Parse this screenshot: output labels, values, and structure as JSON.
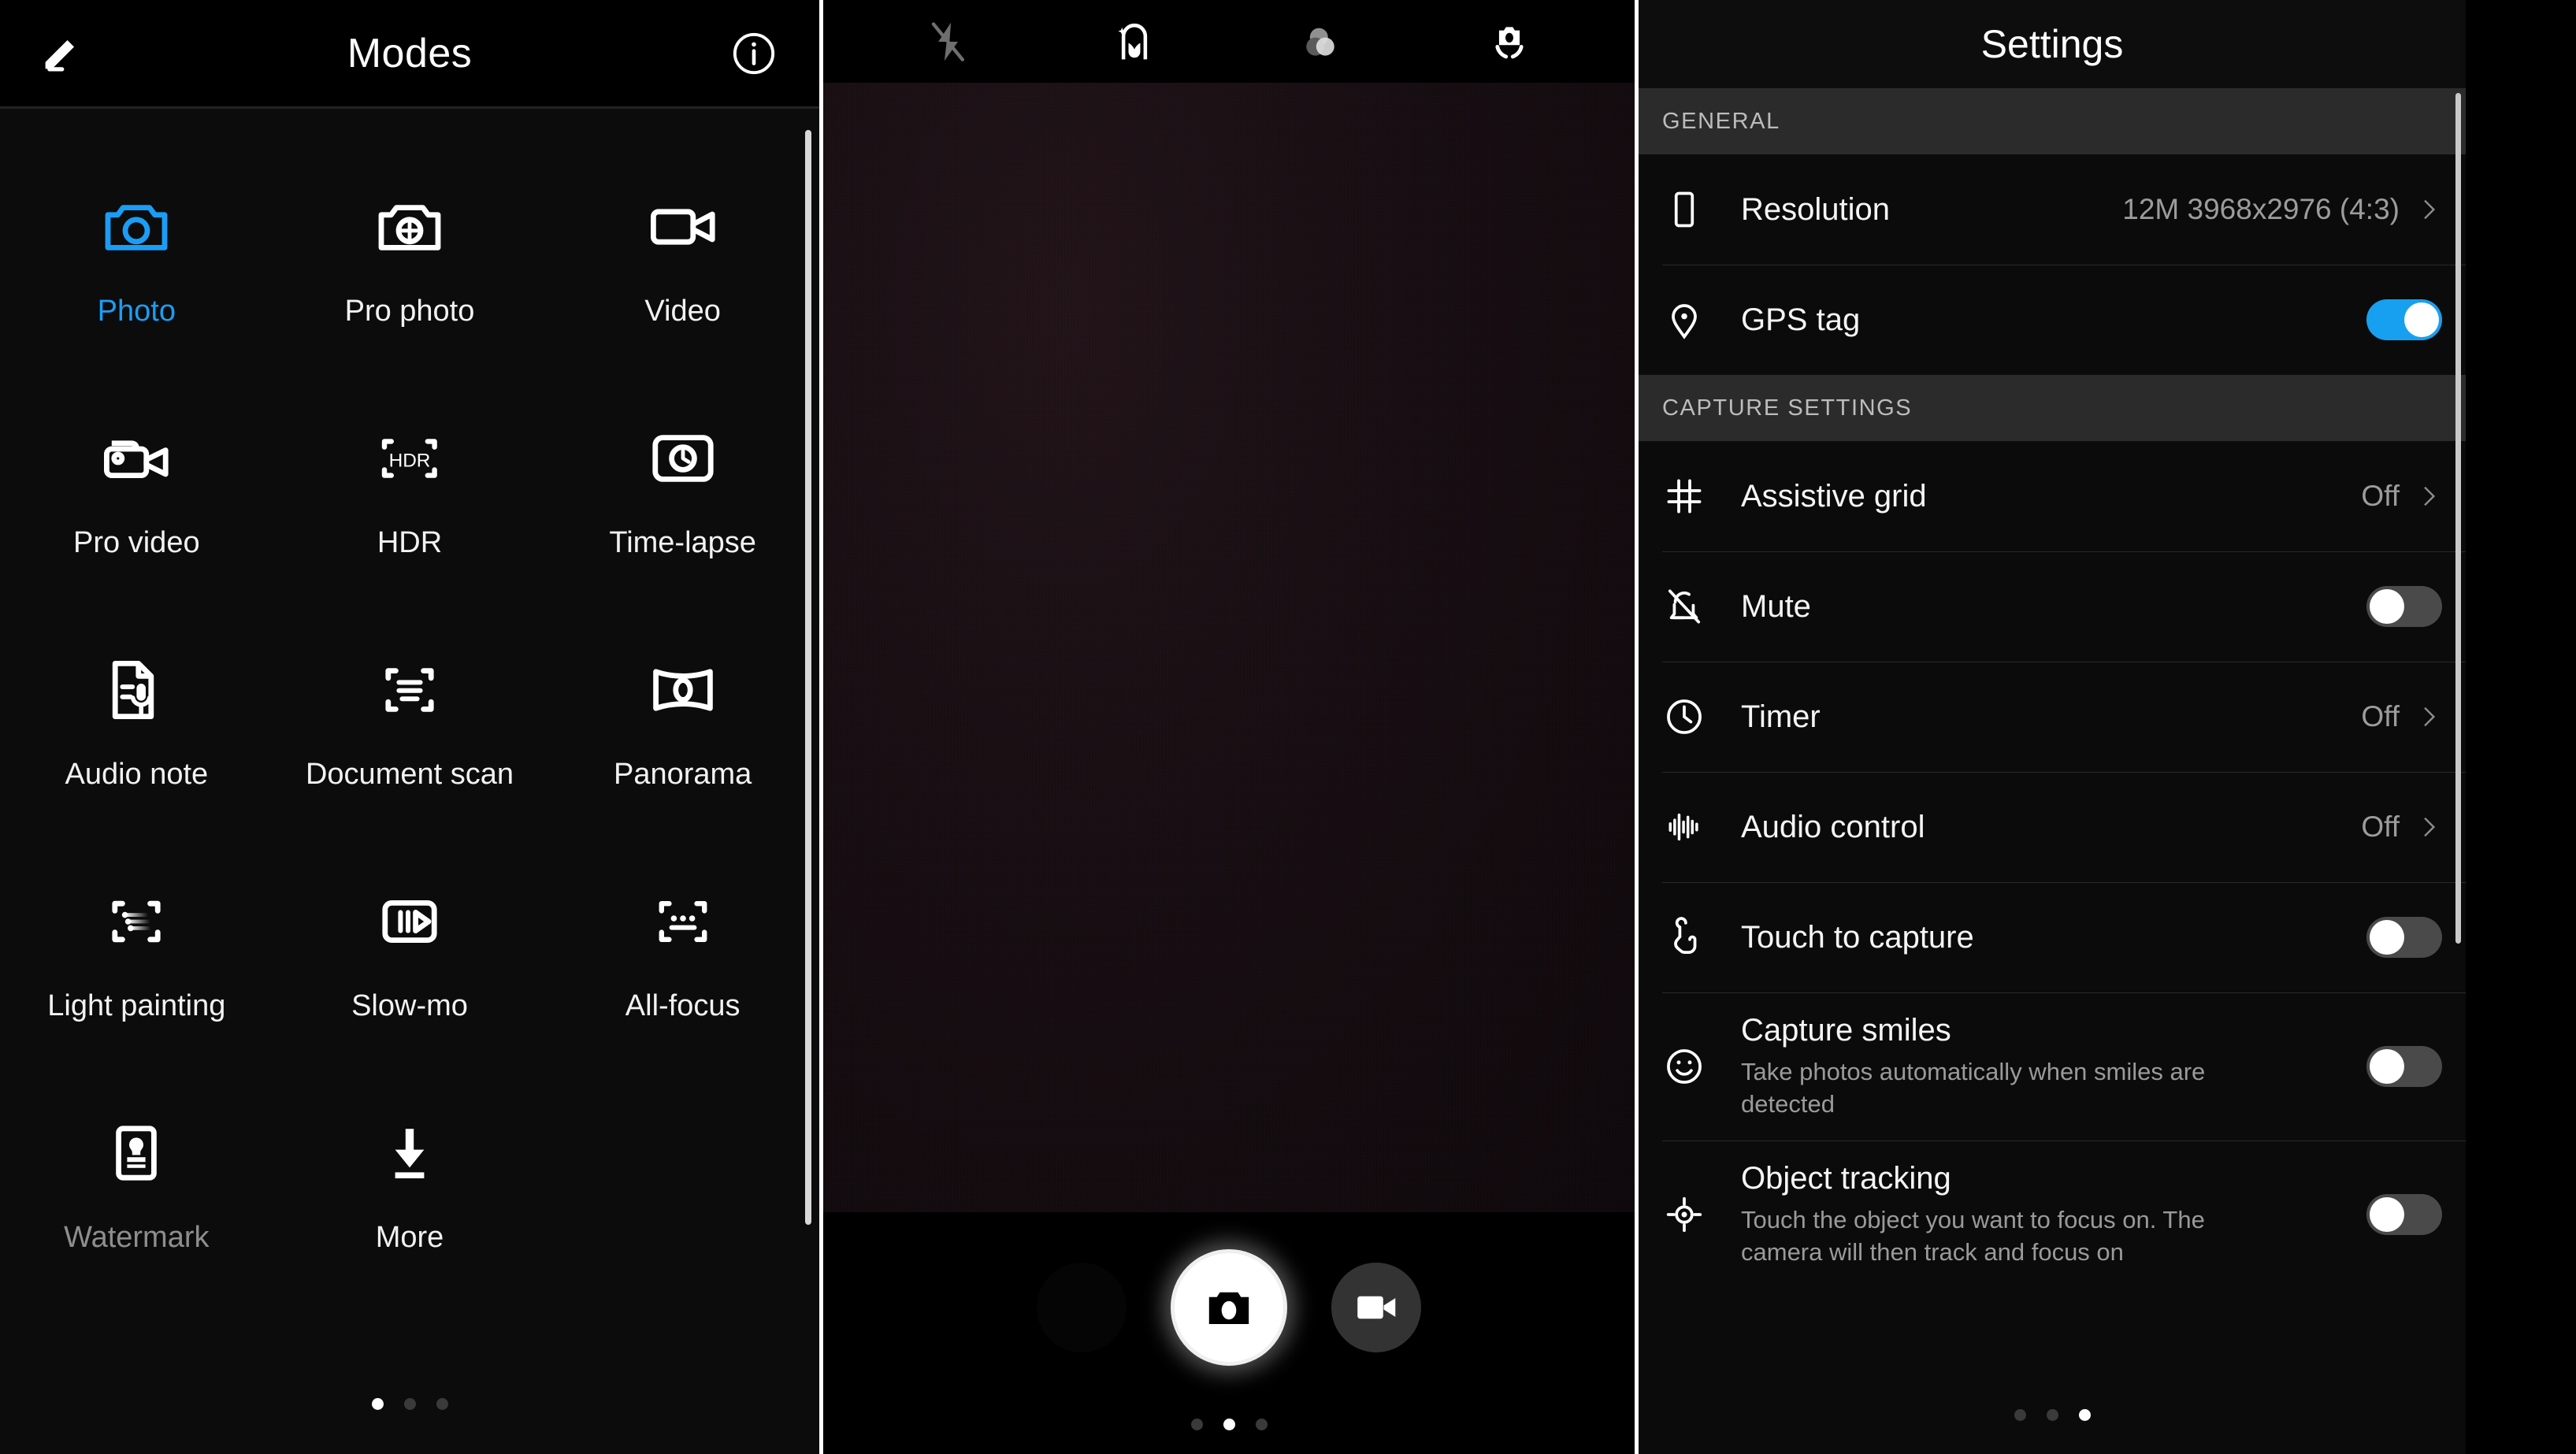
{
  "modes_panel": {
    "header": {
      "title": "Modes",
      "left_icon": "edit-pencil-icon",
      "right_icon": "info-icon"
    },
    "modes": [
      {
        "label": "Photo",
        "icon": "camera-icon",
        "state": "active"
      },
      {
        "label": "Pro photo",
        "icon": "pro-photo-icon",
        "state": "normal"
      },
      {
        "label": "Video",
        "icon": "video-camera-icon",
        "state": "normal"
      },
      {
        "label": "Pro video",
        "icon": "pro-video-icon",
        "state": "normal"
      },
      {
        "label": "HDR",
        "icon": "hdr-icon",
        "state": "normal"
      },
      {
        "label": "Time-lapse",
        "icon": "time-lapse-icon",
        "state": "normal"
      },
      {
        "label": "Audio note",
        "icon": "audio-note-icon",
        "state": "normal"
      },
      {
        "label": "Document scan",
        "icon": "document-scan-icon",
        "state": "normal"
      },
      {
        "label": "Panorama",
        "icon": "panorama-icon",
        "state": "normal"
      },
      {
        "label": "Light painting",
        "icon": "light-painting-icon",
        "state": "normal"
      },
      {
        "label": "Slow-mo",
        "icon": "slow-motion-icon",
        "state": "normal"
      },
      {
        "label": "All-focus",
        "icon": "all-focus-icon",
        "state": "normal"
      },
      {
        "label": "Watermark",
        "icon": "watermark-stamp-icon",
        "state": "dim"
      },
      {
        "label": "More",
        "icon": "download-arrow-icon",
        "state": "normal"
      }
    ],
    "page_dots": {
      "count": 3,
      "active_index": 0
    }
  },
  "viewfinder_panel": {
    "top_icons": [
      {
        "name": "flash-off-icon",
        "state": "dim"
      },
      {
        "name": "beauty-face-icon",
        "state": "normal"
      },
      {
        "name": "filters-icon",
        "state": "normal"
      },
      {
        "name": "switch-camera-icon",
        "state": "normal"
      }
    ],
    "controls": {
      "thumbnail": "last-photo-thumbnail",
      "shutter": "shutter-button",
      "video": "video-record-button"
    },
    "page_dots": {
      "count": 3,
      "active_index": 1
    }
  },
  "settings_panel": {
    "header": {
      "title": "Settings"
    },
    "sections": [
      {
        "title": "GENERAL",
        "rows": [
          {
            "label": "Resolution",
            "icon": "phone-portrait-icon",
            "control": "chevron",
            "value": "12M 3968x2976 (4:3)",
            "desc": ""
          },
          {
            "label": "GPS tag",
            "icon": "location-pin-icon",
            "control": "toggle",
            "toggle_on": true,
            "desc": ""
          }
        ]
      },
      {
        "title": "CAPTURE SETTINGS",
        "rows": [
          {
            "label": "Assistive grid",
            "icon": "grid-hash-icon",
            "control": "chevron",
            "value": "Off",
            "desc": ""
          },
          {
            "label": "Mute",
            "icon": "mute-bell-icon",
            "control": "toggle",
            "toggle_on": false,
            "desc": ""
          },
          {
            "label": "Timer",
            "icon": "clock-icon",
            "control": "chevron",
            "value": "Off",
            "desc": ""
          },
          {
            "label": "Audio control",
            "icon": "audio-waveform-icon",
            "control": "chevron",
            "value": "Off",
            "desc": ""
          },
          {
            "label": "Touch to capture",
            "icon": "touch-hand-icon",
            "control": "toggle",
            "toggle_on": false,
            "desc": ""
          },
          {
            "label": "Capture smiles",
            "icon": "smiley-face-icon",
            "control": "toggle",
            "toggle_on": false,
            "desc": "Take photos automatically when smiles are detected"
          },
          {
            "label": "Object tracking",
            "icon": "crosshair-target-icon",
            "control": "toggle",
            "toggle_on": false,
            "desc": "Touch the object you want to focus on. The camera will then track and focus on"
          }
        ]
      }
    ],
    "page_dots": {
      "count": 3,
      "active_index": 2
    }
  },
  "colors": {
    "accent_blue": "#1b9df5",
    "toggle_on": "#18a0f0",
    "toggle_off": "#4a4a4a",
    "panel_bg": "#0c0c0c",
    "section_bg": "#2b2b2b",
    "label_white": "#f5f5f5",
    "muted_gray": "#9a9a9a"
  }
}
